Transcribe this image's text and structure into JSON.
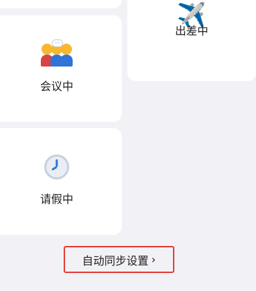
{
  "cards": [
    {
      "id": "top-left",
      "label": ""
    },
    {
      "id": "business",
      "label": "出差中",
      "icon": "airplane-icon"
    },
    {
      "id": "meeting",
      "label": "会议中",
      "icon": "meeting-people-icon"
    },
    {
      "id": "leave",
      "label": "请假中",
      "icon": "clock-icon"
    }
  ],
  "footer": {
    "sync_settings_label": "自动同步设置",
    "chevron": "›"
  },
  "colors": {
    "background": "#f2f2f6",
    "card": "#ffffff",
    "highlight_border": "#e53935"
  }
}
